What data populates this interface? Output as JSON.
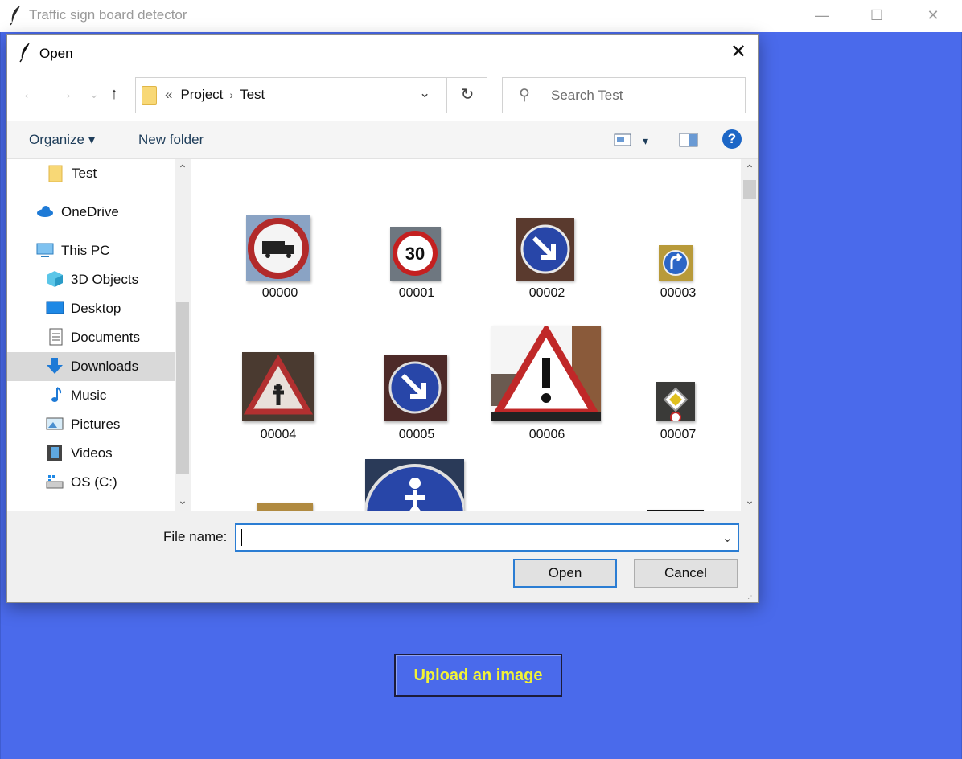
{
  "app": {
    "title": "Traffic sign board detector",
    "controls": {
      "minimize": "—",
      "maximize": "☐",
      "close": "✕"
    },
    "upload_button": "Upload an image",
    "background_color": "#4a6aeb",
    "upload_text_color": "#f2f236"
  },
  "dialog": {
    "title": "Open",
    "close": "✕",
    "nav": {
      "back": "←",
      "forward": "→",
      "recent": "⌄",
      "up": "↑"
    },
    "address": {
      "prefix": "«",
      "crumbs": [
        "Project",
        "Test"
      ],
      "separator": "›",
      "dropdown": "⌄",
      "refresh": "↻"
    },
    "search": {
      "icon": "⚲",
      "placeholder": "Search Test"
    },
    "toolbar": {
      "organize": "Organize ▾",
      "new_folder": "New folder",
      "view_dropdown": "▾",
      "help": "?"
    },
    "nav_pane": [
      {
        "label": "Test",
        "icon": "folder-icon"
      },
      {
        "label": "OneDrive",
        "icon": "cloud-icon"
      },
      {
        "label": "This PC",
        "icon": "computer-icon"
      },
      {
        "label": "3D Objects",
        "icon": "cube-icon"
      },
      {
        "label": "Desktop",
        "icon": "desktop-icon"
      },
      {
        "label": "Documents",
        "icon": "document-icon"
      },
      {
        "label": "Downloads",
        "icon": "download-icon",
        "selected": true
      },
      {
        "label": "Music",
        "icon": "music-icon"
      },
      {
        "label": "Pictures",
        "icon": "pictures-icon"
      },
      {
        "label": "Videos",
        "icon": "videos-icon"
      },
      {
        "label": "OS (C:)",
        "icon": "drive-icon"
      }
    ],
    "files": [
      "00000",
      "00001",
      "00002",
      "00003",
      "00004",
      "00005",
      "00006",
      "00007"
    ],
    "file_name_label": "File name:",
    "file_name_value": "",
    "open_button": "Open",
    "cancel_button": "Cancel"
  }
}
